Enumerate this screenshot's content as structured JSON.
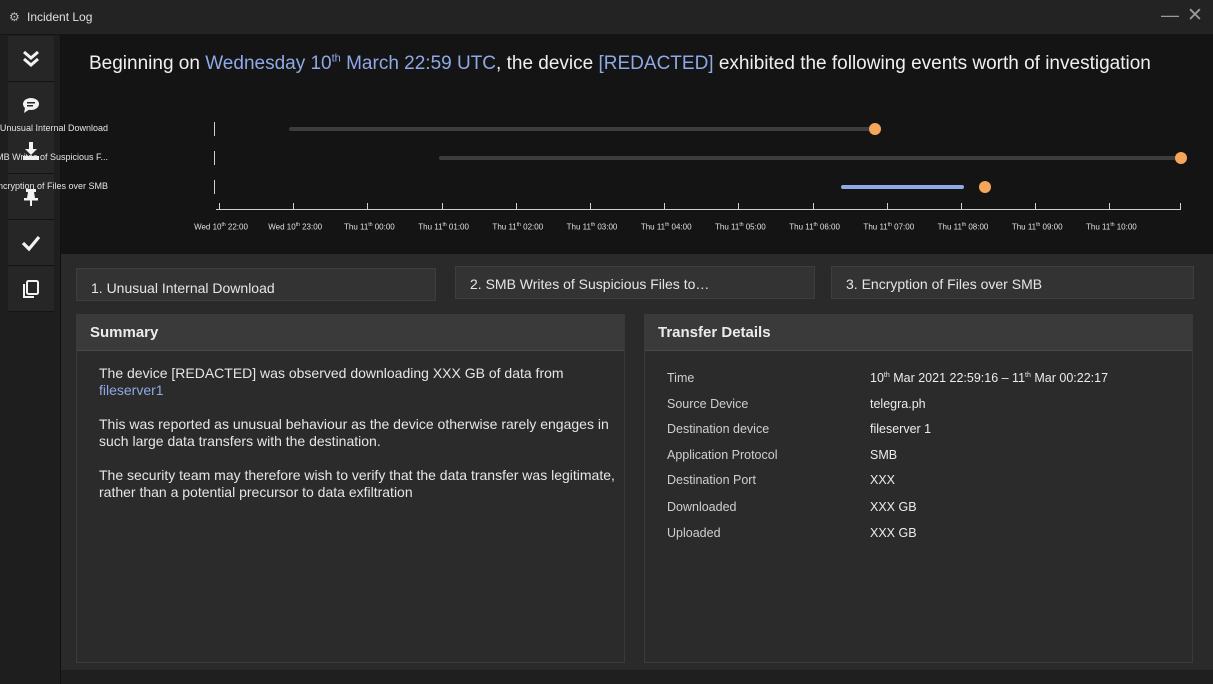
{
  "window": {
    "title": "Incident Log",
    "minimize_glyph": "—",
    "close_glyph": "✕"
  },
  "toolbar": {
    "items": [
      {
        "name": "collapse",
        "icon": "double-chevron-down-icon"
      },
      {
        "name": "comment",
        "icon": "comment-icon"
      },
      {
        "name": "download",
        "icon": "download-icon"
      },
      {
        "name": "pin",
        "icon": "pin-icon"
      },
      {
        "name": "acknowledge",
        "icon": "checkmark-icon"
      },
      {
        "name": "copy",
        "icon": "copy-icon"
      }
    ]
  },
  "header": {
    "prefix": "Beginning on ",
    "date_day": "Wednesday 10",
    "date_sup": "th",
    "date_rest": " March 22:59 UTC",
    "middle": ", the device ",
    "device": "[REDACTED]",
    "suffix": " exhibited the following events worth of investigation"
  },
  "timeline": {
    "events": [
      {
        "label": "Unusual Internal Download",
        "start": "Wed 10 22:59",
        "end": "Thu 11 06:50",
        "dot": "Thu 11 06:53",
        "bar_color": "#3d3d3d"
      },
      {
        "label": "SMB Writes of Suspicious F...",
        "start": "Thu 11 01:00",
        "end": "Thu 11 11:00",
        "dot": "Thu 11 11:00",
        "bar_color": "#3d3d3d"
      },
      {
        "label": "Encryption of Files over SMB",
        "start": "Thu 11 06:25",
        "end": "Thu 11 08:05",
        "dot": "Thu 11 08:22",
        "bar_color": "#8fa8e6"
      }
    ],
    "x_ticks": [
      {
        "pre": "Wed 10",
        "sup": "th",
        "post": " 22:00"
      },
      {
        "pre": "Wed 10",
        "sup": "th",
        "post": " 23:00"
      },
      {
        "pre": "Thu 11",
        "sup": "th",
        "post": " 00:00"
      },
      {
        "pre": "Thu 11",
        "sup": "th",
        "post": " 01:00"
      },
      {
        "pre": "Thu 11",
        "sup": "th",
        "post": " 02:00"
      },
      {
        "pre": "Thu 11",
        "sup": "th",
        "post": " 03:00"
      },
      {
        "pre": "Thu 11",
        "sup": "th",
        "post": " 04:00"
      },
      {
        "pre": "Thu 11",
        "sup": "th",
        "post": " 05:00"
      },
      {
        "pre": "Thu 11",
        "sup": "th",
        "post": " 06:00"
      },
      {
        "pre": "Thu 11",
        "sup": "th",
        "post": " 07:00"
      },
      {
        "pre": "Thu 11",
        "sup": "th",
        "post": " 08:00"
      },
      {
        "pre": "Thu 11",
        "sup": "th",
        "post": " 09:00"
      },
      {
        "pre": "Thu 11",
        "sup": "th",
        "post": " 10:00"
      }
    ],
    "dot_color": "#f5a65b"
  },
  "tabs": [
    {
      "label": "1. Unusual Internal Download",
      "selected": true
    },
    {
      "label": "2. SMB Writes of Suspicious Files to…",
      "selected": false
    },
    {
      "label": "3. Encryption of Files over SMB",
      "selected": false
    }
  ],
  "summary": {
    "title": "Summary",
    "p1_text": "The device [REDACTED] was observed downloading XXX GB of data from ",
    "p1_link": "fileserver1",
    "p2": "This was reported as unusual behaviour as the device otherwise rarely engages in such large data transfers with the destination.",
    "p3": "The security team may therefore wish to verify that the data transfer was legitimate, rather than a potential precursor to data exfiltration"
  },
  "transfer": {
    "title": "Transfer Details",
    "time_label": "Time",
    "time_a": "10",
    "time_a_sup": "th",
    "time_b": " Mar 2021 22:59:16 – 11",
    "time_b_sup": "th",
    "time_c": " Mar 00:22:17",
    "rows": [
      {
        "label": "Source Device",
        "value": "telegra.ph"
      },
      {
        "label": "Destination device",
        "value": "fileserver 1"
      },
      {
        "label": "Application Protocol",
        "value": "SMB"
      },
      {
        "label": "Destination Port",
        "value": "XXX"
      },
      {
        "label": "Downloaded",
        "value": "XXX GB"
      },
      {
        "label": "Uploaded",
        "value": "XXX GB"
      }
    ]
  }
}
